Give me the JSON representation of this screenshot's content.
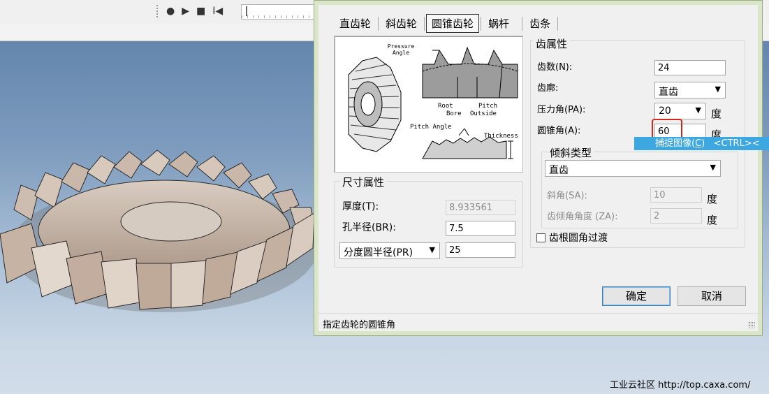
{
  "app": {
    "play_controls": [
      "●",
      "▶",
      "■",
      "I◀"
    ],
    "watermark": "工业云社区 http://top.caxa.com/"
  },
  "dialog": {
    "tabs": [
      "直齿轮",
      "斜齿轮",
      "圆锥齿轮",
      "蜗杆",
      "齿条"
    ],
    "selected_tab": "圆锥齿轮",
    "preview": {
      "pressure_angle": "Pressure Angle",
      "root": "Root",
      "bore": "Bore",
      "pitch": "Pitch",
      "outside": "Outside",
      "pitch_angle": "Pitch Angle",
      "thickness": "Thickness"
    },
    "tooth_props": {
      "title": "齿属性",
      "num_teeth_label": "齿数(N):",
      "num_teeth_value": "24",
      "profile_label": "齿廓:",
      "profile_value": "直齿",
      "pressure_angle_label": "压力角(PA):",
      "pressure_angle_value": "20",
      "pressure_angle_unit": "度",
      "cone_angle_label": "圆锥角(A):",
      "cone_angle_value": "60",
      "cone_angle_unit": "度"
    },
    "tooltip": {
      "prefix": "捕捉图像(",
      "key": "C",
      "suffix": ")",
      "shortcut": "<CTRL><"
    },
    "helix": {
      "title": "倾斜类型",
      "type_value": "直齿",
      "helix_angle_label": "斜角(SA):",
      "helix_angle_value": "10",
      "helix_angle_unit": "度",
      "tooth_angle_label": "齿倾角角度 (ZA):",
      "tooth_angle_value": "2",
      "tooth_angle_unit": "度"
    },
    "root_fillet_label": "齿根圆角过渡",
    "size_props": {
      "title": "尺寸属性",
      "thickness_label": "厚度(T):",
      "thickness_value": "8.933561",
      "bore_label": "孔半径(BR):",
      "bore_value": "7.5",
      "radius_type_value": "分度圆半径(PR)",
      "radius_value": "25"
    },
    "ok_label": "确定",
    "cancel_label": "取消",
    "status_text": "指定齿轮的圆锥角"
  }
}
